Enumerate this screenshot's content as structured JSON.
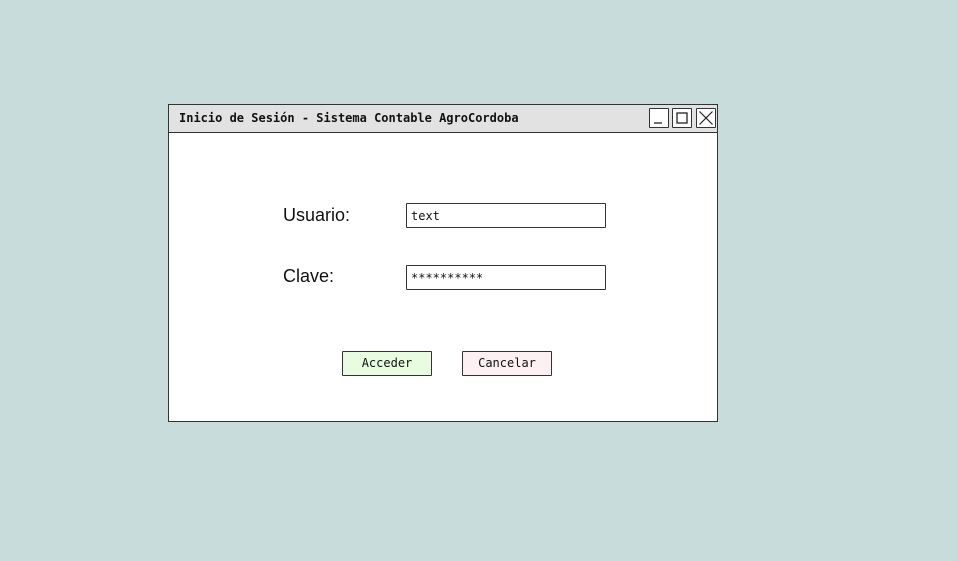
{
  "window": {
    "title": "Inicio de Sesión - Sistema Contable AgroCordoba",
    "controls": {
      "minimize_icon": "minimize-icon",
      "maximize_icon": "maximize-icon",
      "close_icon": "close-icon"
    }
  },
  "form": {
    "user_label": "Usuario:",
    "user_value": "text",
    "password_label": "Clave:",
    "password_value": "**********"
  },
  "buttons": {
    "accept_label": "Acceder",
    "cancel_label": "Cancelar"
  },
  "colors": {
    "background": "#c9dcdc",
    "titlebar": "#e2e2e2",
    "accept_button": "#e8fde0",
    "cancel_button": "#fdf0f3"
  }
}
